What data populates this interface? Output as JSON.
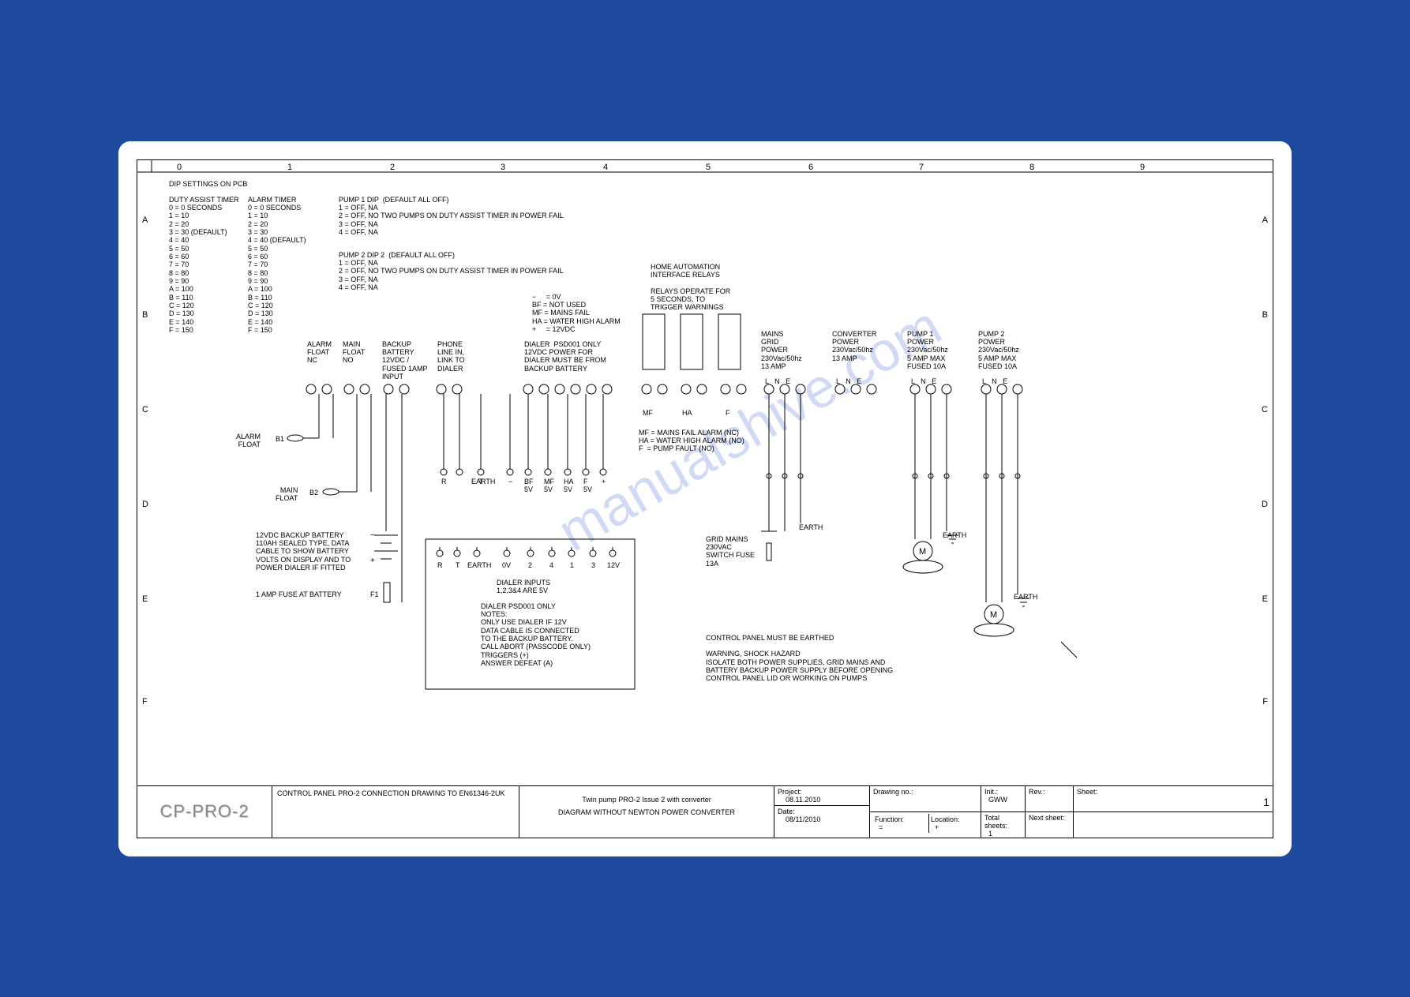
{
  "watermark": "manualshive.com",
  "headers": {
    "cols": [
      "0",
      "1",
      "2",
      "3",
      "4",
      "5",
      "6",
      "7",
      "8",
      "9"
    ],
    "rows": [
      "A",
      "B",
      "C",
      "D",
      "E",
      "F"
    ]
  },
  "dip_title": "DIP SETTINGS ON PCB",
  "duty_assist": {
    "title": "DUTY ASSIST TIMER",
    "lines": [
      "0 = 0 SECONDS",
      "1 = 10",
      "2 = 20",
      "3 = 30 (DEFAULT)",
      "4 = 40",
      "5 = 50",
      "6 = 60",
      "7 = 70",
      "8 = 80",
      "9 = 90",
      "A = 100",
      "B = 110",
      "C = 120",
      "D = 130",
      "E = 140",
      "F = 150"
    ]
  },
  "alarm_timer": {
    "title": "ALARM TIMER",
    "lines": [
      "0 = 0 SECONDS",
      "1 = 10",
      "2 = 20",
      "3 = 30",
      "4 = 40 (DEFAULT)",
      "5 = 50",
      "6 = 60",
      "7 = 70",
      "8 = 80",
      "9 = 90",
      "A = 100",
      "B = 110",
      "C = 120",
      "D = 130",
      "E = 140",
      "F = 150"
    ]
  },
  "pump1_dip": {
    "title": "PUMP 1 DIP  (DEFAULT ALL OFF)",
    "lines": [
      "1 = OFF, NA",
      "2 = OFF, NO TWO PUMPS ON DUTY ASSIST TIMER IN POWER FAIL",
      "3 = OFF, NA",
      "4 = OFF, NA"
    ]
  },
  "pump2_dip": {
    "title": "PUMP 2 DIP 2  (DEFAULT ALL OFF)",
    "lines": [
      "1 = OFF, NA",
      "2 = OFF, NO TWO PUMPS ON DUTY ASSIST TIMER IN POWER FAIL",
      "3 = OFF, NA",
      "4 = OFF, NA"
    ]
  },
  "legend1": [
    "−     = 0V",
    "BF = NOT USED",
    "MF = MAINS FAIL",
    "HA = WATER HIGH ALARM",
    "+     = 12VDC"
  ],
  "home_auto": [
    "HOME AUTOMATION",
    "INTERFACE RELAYS",
    "",
    "RELAYS OPERATE FOR",
    "5 SECONDS, TO",
    "TRIGGER WARNINGS"
  ],
  "term_labels": {
    "alarm_float": "ALARM\nFLOAT\nNC",
    "main_float": "MAIN\nFLOAT\nNO",
    "backup_batt": "BACKUP\nBATTERY\n12VDC /\nFUSED 1AMP\nINPUT",
    "phone": "PHONE\nLINE IN,\nLINK TO\nDIALER",
    "dialer": "DIALER  PSD001 ONLY\n12VDC POWER FOR\nDIALER MUST BE FROM\nBACKUP BATTERY",
    "mains_grid": "MAINS\nGRID\nPOWER\n230Vac/50hz\n13 AMP",
    "converter": "CONVERTER\nPOWER\n230Vac/50hz\n13 AMP",
    "pump1": "PUMP 1\nPOWER\n230Vac/50hz\n5 AMP MAX\nFUSED 10A",
    "pump2": "PUMP 2\nPOWER\n230Vac/50hz\n5 AMP MAX\nFUSED 10A"
  },
  "relay_labels": [
    "MF",
    "HA",
    "F"
  ],
  "relay_legend": [
    "MF = MAINS FAIL ALARM (NC)",
    "HA = WATER HIGH ALARM (NO)",
    "F  = PUMP FAULT (NO)"
  ],
  "float_names": {
    "alarm": "ALARM\nFLOAT",
    "main": "MAIN\nFLOAT",
    "b1": "B1",
    "b2": "B2"
  },
  "battery_note": [
    "12VDC BACKUP BATTERY",
    "110AH SEALED TYPE, DATA",
    "CABLE TO SHOW BATTERY",
    "VOLTS ON DISPLAY AND TO",
    "POWER DIALER IF FITTED"
  ],
  "fuse_note": "1 AMP FUSE AT BATTERY",
  "fuse_label": "F1",
  "row_d_terms": [
    "R",
    "T",
    "EARTH",
    "−",
    "BF\n5V",
    "MF\n5V",
    "HA\n5V",
    "F\n5V",
    "+"
  ],
  "row_e_terms": [
    "R",
    "T",
    "EARTH",
    "0V",
    "2",
    "4",
    "1",
    "3",
    "12V"
  ],
  "dialer_inputs": [
    "DIALER INPUTS",
    "1,2,3&4 ARE 5V"
  ],
  "dialer_notes": [
    "DIALER PSD001 ONLY",
    "NOTES:",
    "ONLY USE DIALER IF 12V",
    "DATA CABLE IS CONNECTED",
    "TO THE BACKUP BATTERY.",
    "CALL ABORT (PASSCODE ONLY)",
    "TRIGGERS (+)",
    "ANSWER DEFEAT (A)"
  ],
  "grid_switch": [
    "GRID MAINS",
    "230VAC",
    "SWITCH FUSE",
    "13A"
  ],
  "earth_labels": {
    "e1": "EARTH",
    "e2": "EARTH",
    "e3": "EARTH"
  },
  "lne": "L   N   E",
  "warning": [
    "CONTROL PANEL MUST BE EARTHED",
    "",
    "WARNING, SHOCK HAZARD",
    "ISOLATE BOTH POWER SUPPLIES, GRID MAINS AND",
    "BATTERY BACKUP POWER SUPPLY BEFORE OPENING",
    "CONTROL PANEL LID OR WORKING ON PUMPS"
  ],
  "motor": "M",
  "titleblock": {
    "logo": "CP-PRO-2",
    "drawing_title": [
      "CONTROL PANEL PRO-2 CONNECTION DRAWING",
      "TO EN61346-2UK"
    ],
    "subtitle": [
      "Twin pump PRO-2 Issue 2 with converter",
      "DIAGRAM WITHOUT NEWTON POWER CONVERTER"
    ],
    "project_lbl": "Project:",
    "project_val": "08.11.2010",
    "date_lbl": "Date:",
    "date_val": "08/11/2010",
    "drawing_no_lbl": "Drawing no.:",
    "function_lbl": "Function:",
    "function_val": "=",
    "location_lbl": "Location:",
    "location_val": "+",
    "init_lbl": "Init.:",
    "init_val": "GWW",
    "rev_lbl": "Rev.:",
    "sheet_lbl": "Sheet:",
    "sheet_val": "1",
    "total_lbl": "Total sheets:",
    "total_val": "1",
    "next_lbl": "Next sheet:"
  }
}
